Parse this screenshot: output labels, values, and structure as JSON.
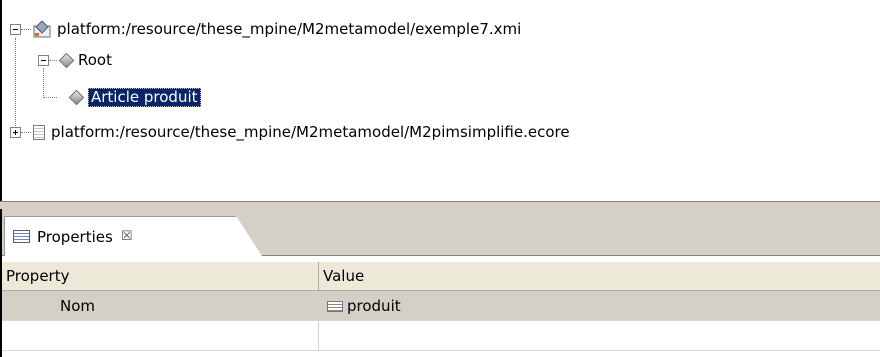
{
  "tree": {
    "items": [
      {
        "label": "platform:/resource/these_mpine/M2metamodel/exemple7.xmi",
        "icon": "package-icon",
        "expanded": true
      },
      {
        "label": "Root",
        "icon": "diamond-icon",
        "expanded": true
      },
      {
        "label": "Article produit",
        "icon": "diamond-icon",
        "selected": true
      },
      {
        "label": "platform:/resource/these_mpine/M2metamodel/M2pimsimplifie.ecore",
        "icon": "document-icon",
        "expanded": false
      }
    ]
  },
  "properties": {
    "tab_label": "Properties",
    "tab_close": "☒",
    "columns": [
      "Property",
      "Value"
    ],
    "rows": [
      {
        "property": "Nom",
        "value": "produit"
      }
    ]
  }
}
